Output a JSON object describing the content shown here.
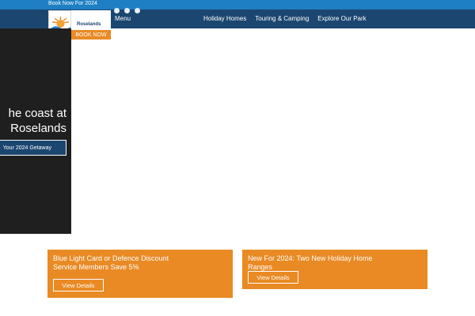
{
  "topbar": {
    "text": "Book Now For 2024"
  },
  "header": {
    "logo_text": "Roselands",
    "menu_label": "Menu",
    "book_now_label": "BOOK NOW",
    "nav_links": [
      "Holiday Homes",
      "Touring & Camping",
      "Explore Our Park"
    ]
  },
  "hero": {
    "title_line1": "he coast at",
    "title_line2": "Roselands",
    "button_label": "Your 2024 Getaway"
  },
  "cards": [
    {
      "title": "Blue Light Card or Defence Discount Service Members Save 5%",
      "button_label": "View Details"
    },
    {
      "title": "New For 2024: Two New Holiday Home Ranges",
      "button_label": "View Details"
    }
  ],
  "colors": {
    "accent": "#e98a24",
    "navy": "#1b4670",
    "topbar": "#1f7fc4",
    "hero_bg": "#1f1f1f"
  }
}
